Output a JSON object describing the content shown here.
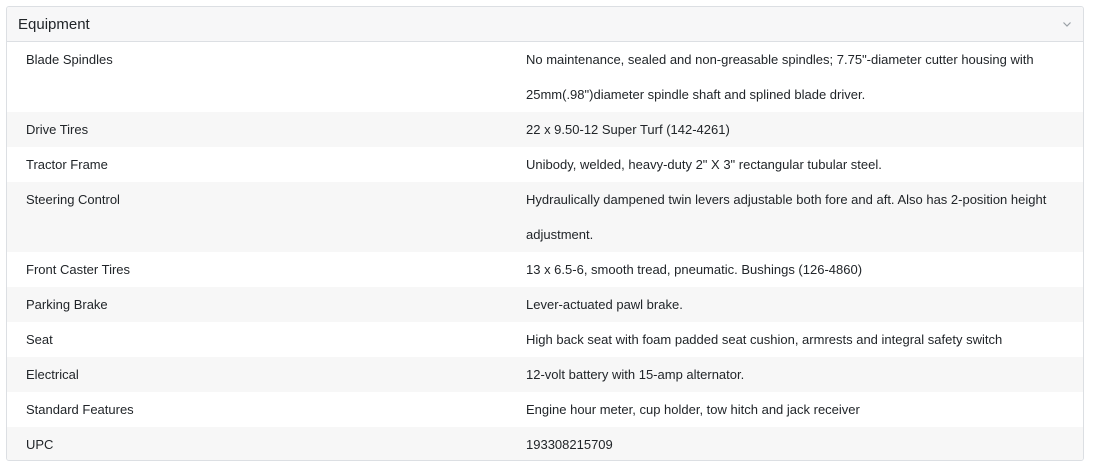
{
  "panel": {
    "title": "Equipment",
    "chevron_icon": "chevron-down-icon"
  },
  "rows": [
    {
      "label": "Blade Spindles",
      "value": "No maintenance, sealed and non-greasable spindles; 7.75\"-diameter cutter housing with 25mm(.98\")diameter spindle shaft and splined blade driver."
    },
    {
      "label": "Drive Tires",
      "value": "22 x 9.50-12 Super Turf (142-4261)"
    },
    {
      "label": "Tractor Frame",
      "value": "Unibody, welded, heavy-duty 2\" X 3\" rectangular tubular steel."
    },
    {
      "label": "Steering Control",
      "value": "Hydraulically dampened twin levers adjustable both fore and aft. Also has 2-position height adjustment."
    },
    {
      "label": "Front Caster Tires",
      "value": "13 x 6.5-6, smooth tread, pneumatic. Bushings (126-4860)"
    },
    {
      "label": "Parking Brake",
      "value": "Lever-actuated pawl brake."
    },
    {
      "label": "Seat",
      "value": "High back seat with foam padded seat cushion, armrests and integral safety switch"
    },
    {
      "label": "Electrical",
      "value": "12-volt battery with 15-amp alternator."
    },
    {
      "label": "Standard Features",
      "value": "Engine hour meter, cup holder, tow hitch and jack receiver"
    },
    {
      "label": "UPC",
      "value": "193308215709"
    }
  ]
}
